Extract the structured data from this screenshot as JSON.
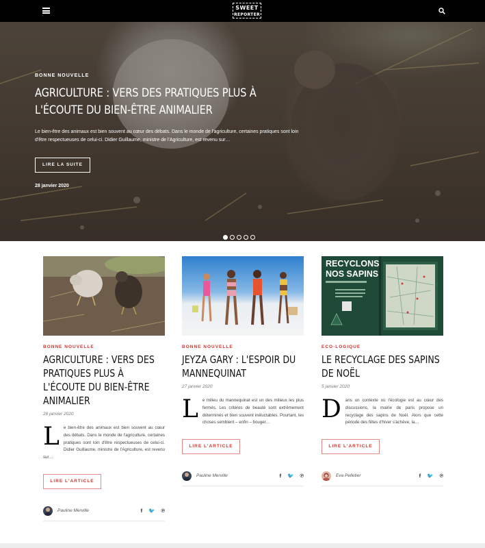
{
  "header": {
    "menu_icon": "hamburger-menu-icon",
    "logo": {
      "line1": "SWEET",
      "line2": "REPORTER"
    },
    "search_icon": "search-icon"
  },
  "hero": {
    "category": "BONNE NOUVELLE",
    "title": "AGRICULTURE : VERS DES PRATIQUES PLUS À L'ÉCOUTE DU BIEN-ÊTRE ANIMALIER",
    "excerpt": "Le bien-être des animaux est bien souvent au cœur des débats. Dans le monde de l'agriculture, certaines pratiques sont loin d'être respectueuses de celui-ci. Didier Guillaume, ministre de l'Agriculture, est revenu sur…",
    "button_label": "LIRE LA SUITE",
    "date": "28 janvier 2020",
    "slides_total": 5,
    "active_slide": 1
  },
  "articles": [
    {
      "category": "BONNE NOUVELLE",
      "title": "AGRICULTURE : VERS DES PRATIQUES PLUS À L'ÉCOUTE DU BIEN-ÊTRE ANIMALIER",
      "date": "28 janvier 2020",
      "dropcap": "L",
      "excerpt": "e bien-être des animaux est bien souvent au cœur des débats. Dans le monde de l'agriculture, certaines pratiques sont loin d'être respectueuses de celui-ci. Didier Guillaume, ministre de l'Agriculture, est revenu sur…",
      "button_label": "LIRE L'ARTICLE",
      "author": "Pauline Merville"
    },
    {
      "category": "BONNE NOUVELLE",
      "title": "JEYZA GARY : L'ESPOIR DU MANNEQUINAT",
      "date": "27 janvier 2020",
      "dropcap": "L",
      "excerpt": "e milieu du mannequinat est un des milieux les plus fermés. Les critères de beauté sont extrêmement déterminés et bien souvent inéluctables. Pourtant, les choses semblent – enfin – bouger…",
      "button_label": "LIRE L'ARTICLE",
      "author": "Pauline Merville"
    },
    {
      "category": "ECO-LOGIQUE",
      "title": "LE RECYCLAGE DES SAPINS DE NOËL",
      "date": "5 janvier 2020",
      "dropcap": "D",
      "excerpt": "ans un contexte où l'écologie est au cœur des discussions, la mairie de paris propose un recyclage des sapins de Noël. Alors que cette période des fêtes d'hiver s'achève, la…",
      "button_label": "LIRE L'ARTICLE",
      "author": "Eva Pelletier",
      "image_text": {
        "line1": "RECYCLONS",
        "line2": "NOS SAPINS"
      }
    }
  ],
  "social": {
    "facebook": "f",
    "twitter": "🐦",
    "pinterest": "℗"
  },
  "colors": {
    "accent": "#d2342c",
    "topbar": "#000000"
  }
}
